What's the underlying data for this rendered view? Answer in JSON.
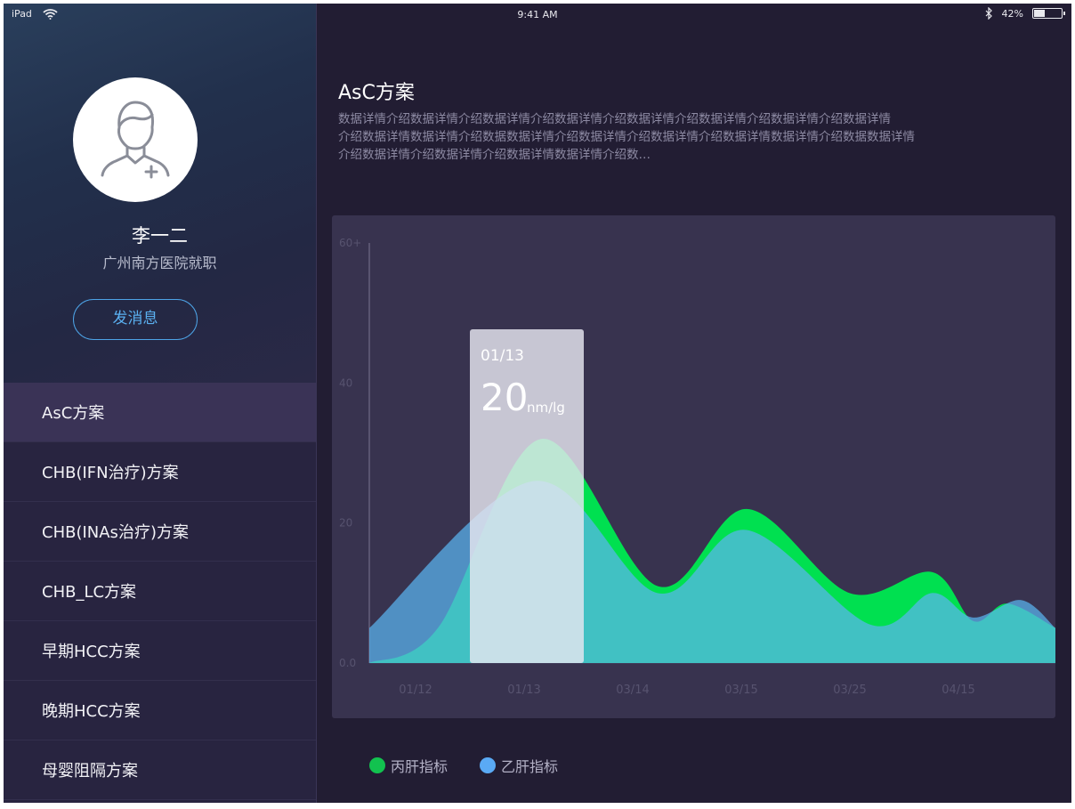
{
  "status_bar": {
    "device": "iPad",
    "time": "9:41 AM",
    "battery_text": "42%",
    "battery_level": 0.42
  },
  "profile": {
    "name": "李一二",
    "hospital": "广州南方医院就职",
    "message_button": "发消息"
  },
  "menu": [
    {
      "label": "AsC方案",
      "active": true
    },
    {
      "label": "CHB(IFN治疗)方案",
      "active": false
    },
    {
      "label": "CHB(INAs治疗)方案",
      "active": false
    },
    {
      "label": "CHB_LC方案",
      "active": false
    },
    {
      "label": "早期HCC方案",
      "active": false
    },
    {
      "label": "晚期HCC方案",
      "active": false
    },
    {
      "label": "母婴阻隔方案",
      "active": false
    }
  ],
  "content": {
    "title": "AsC方案",
    "description_lines": [
      "数据详情介绍数据详情介绍数据详情介绍数据详情介绍数据详情介绍数据详情介绍数据详情介绍数据详情",
      "介绍数据详情数据详情介绍数据数据详情介绍数据详情介绍数据详情介绍数据详情数据详情介绍数据数据详情",
      "介绍数据详情介绍数据详情介绍数据详情数据详情介绍数…"
    ]
  },
  "chart_data": {
    "type": "area",
    "categories": [
      "01/12",
      "01/13",
      "03/14",
      "03/15",
      "03/25",
      "04/15"
    ],
    "y_ticks": [
      "60+",
      "40",
      "20",
      "0.0"
    ],
    "ylim": [
      0,
      60
    ],
    "series": [
      {
        "name": "丙肝指标",
        "color": "#00e050",
        "points": [
          [
            0,
            0
          ],
          [
            0.1,
            5
          ],
          [
            0.25,
            32
          ],
          [
            0.42,
            11
          ],
          [
            0.55,
            22
          ],
          [
            0.7,
            10
          ],
          [
            0.82,
            13
          ],
          [
            0.88,
            6
          ],
          [
            0.93,
            8.5
          ],
          [
            1,
            5
          ]
        ]
      },
      {
        "name": "乙肝指标",
        "color": "#5ab4f0",
        "points": [
          [
            0,
            5
          ],
          [
            0.24,
            26
          ],
          [
            0.42,
            10
          ],
          [
            0.55,
            19
          ],
          [
            0.73,
            5.5
          ],
          [
            0.82,
            10
          ],
          [
            0.88,
            6.5
          ],
          [
            0.95,
            9
          ],
          [
            1,
            5
          ]
        ]
      }
    ],
    "tooltip": {
      "date": "01/13",
      "value": "20",
      "unit": "nm/lg"
    }
  },
  "legend": [
    {
      "label": "丙肝指标",
      "color": "#12c24f"
    },
    {
      "label": "乙肝指标",
      "color": "#5aaaf5"
    }
  ]
}
